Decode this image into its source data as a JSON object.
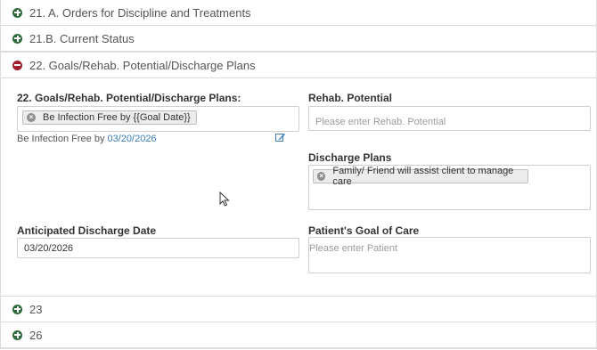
{
  "sections": {
    "s21a": "21. A. Orders for Discipline and Treatments",
    "s21b": "21.B. Current Status",
    "s22": "22. Goals/Rehab. Potential/Discharge Plans",
    "s23": "23",
    "s26": "26"
  },
  "goals": {
    "label": "22. Goals/Rehab. Potential/Discharge Plans:",
    "tag": "Be Infection Free by {{Goal Date}}",
    "preview_text": "Be Infection Free by ",
    "preview_date": "03/20/2026"
  },
  "rehab": {
    "label": "Rehab. Potential",
    "placeholder": "Please enter Rehab. Potential"
  },
  "discharge_plans": {
    "label": "Discharge Plans",
    "tag": "Family/ Friend will assist client to manage care"
  },
  "anticipated": {
    "label": "Anticipated Discharge Date",
    "value": "03/20/2026"
  },
  "goal_of_care": {
    "label": "Patient's Goal of Care",
    "placeholder": "Please enter Patient"
  },
  "colors": {
    "expand_icon": "#2f6a3a",
    "collapse_icon": "#a01d2c",
    "link": "#3a7fc1"
  },
  "icons": {
    "expand": "plus-circle-icon",
    "collapse": "minus-circle-icon",
    "remove_tag": "close-circle-icon",
    "edit": "edit-icon",
    "cursor": "mouse-pointer-icon"
  }
}
